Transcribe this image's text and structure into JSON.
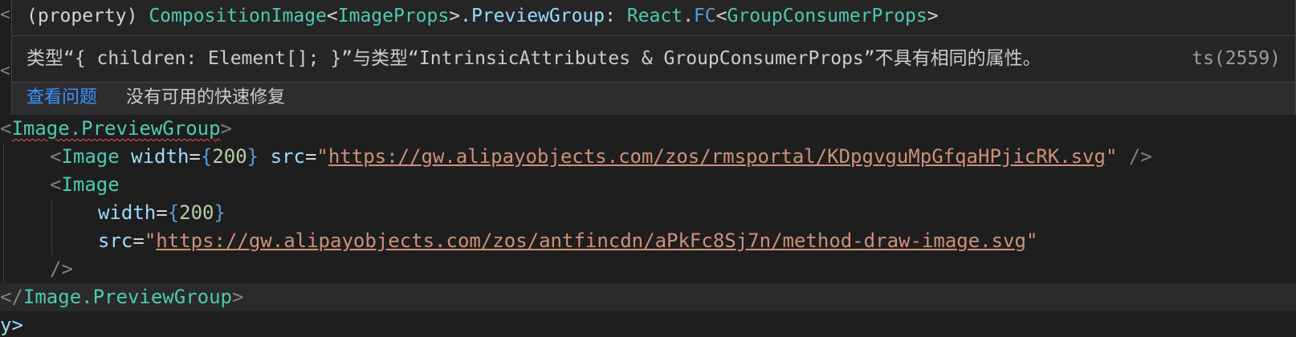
{
  "hover": {
    "signature": {
      "prefix": "(property) ",
      "type1": "CompositionImage",
      "lt1": "<",
      "type2": "ImageProps",
      "gt1": ">",
      "dot": ".",
      "member": "PreviewGroup",
      "colon": ": ",
      "ns": "React",
      "dot2": ".",
      "fc": "FC",
      "lt2": "<",
      "type3": "GroupConsumerProps",
      "gt2": ">"
    },
    "message": "类型“{ children: Element[]; }”与类型“IntrinsicAttributes & GroupConsumerProps”不具有相同的属性。",
    "error_code": "ts(2559)",
    "view_problem_label": "查看问题",
    "no_fix_label": "没有可用的快速修复"
  },
  "code": {
    "line1": {
      "lt": "<",
      "name": "Image.PreviewGroup",
      "gt": ">"
    },
    "line2": {
      "lt": "<",
      "name": "Image",
      "attr1": "width",
      "eq1": "=",
      "ob1": "{",
      "val1": "200",
      "cb1": "}",
      "attr2": "src",
      "eq2": "=",
      "q1": "\"",
      "url": "https://gw.alipayobjects.com/zos/rmsportal/KDpgvguMpGfqaHPjicRK.svg",
      "q2": "\"",
      "close": "/>"
    },
    "line3": {
      "lt": "<",
      "name": "Image"
    },
    "line4": {
      "attr": "width",
      "eq": "=",
      "ob": "{",
      "val": "200",
      "cb": "}"
    },
    "line5": {
      "attr": "src",
      "eq": "=",
      "q1": "\"",
      "url": "https://gw.alipayobjects.com/zos/antfincdn/aPkFc8Sj7n/method-draw-image.svg",
      "q2": "\""
    },
    "line6": {
      "close": "/>"
    },
    "line7": {
      "lt": "</",
      "name": "Image.PreviewGroup",
      "gt": ">"
    },
    "line8": {
      "text": "y>"
    }
  },
  "edge": {
    "top": "<",
    "mid": "<"
  },
  "colors": {
    "background": "#1e1e1e",
    "component": "#4ec9b0",
    "attribute": "#9cdcfe",
    "string": "#ce9178",
    "number": "#b5cea8",
    "link": "#3794ff",
    "error": "#f14c4c"
  }
}
